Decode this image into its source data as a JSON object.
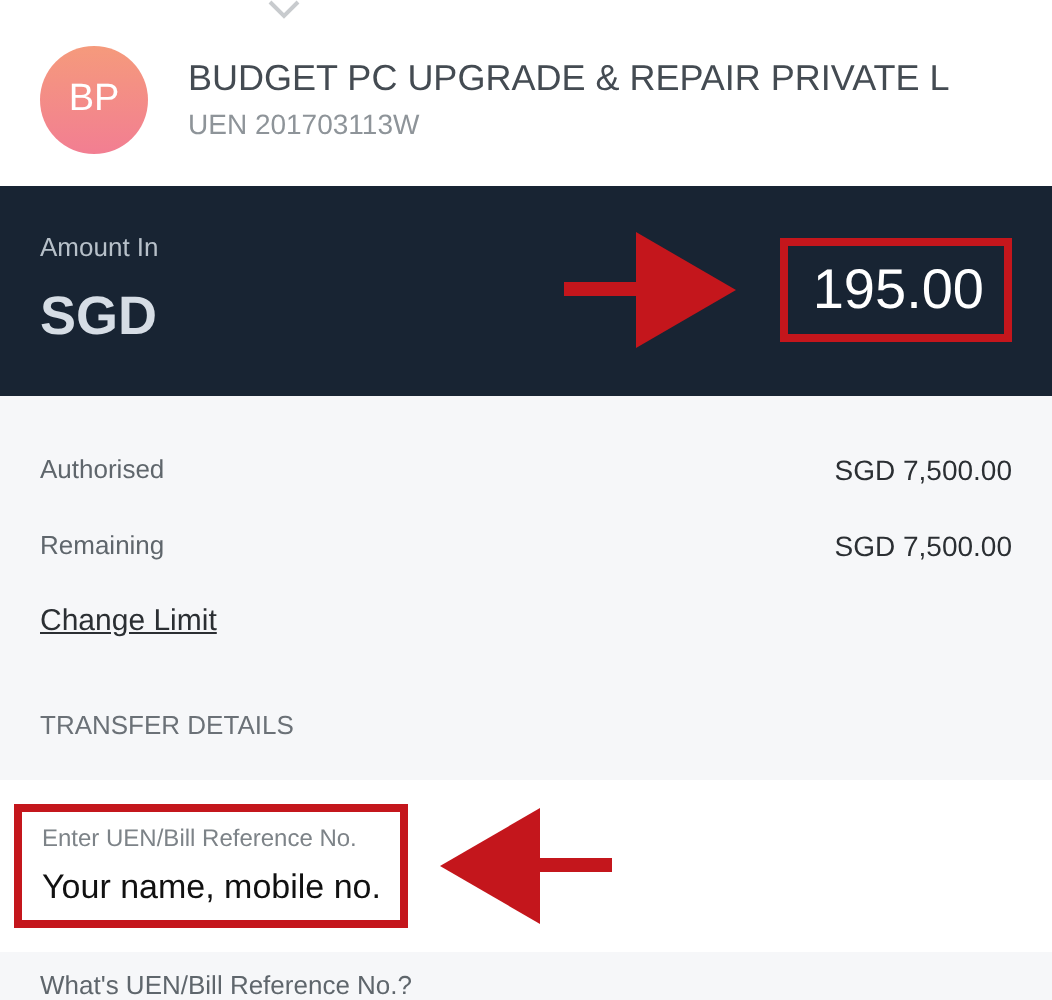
{
  "payee": {
    "initials": "BP",
    "name": "BUDGET PC UPGRADE & REPAIR PRIVATE L",
    "uen": "UEN 201703113W"
  },
  "amount": {
    "label": "Amount In",
    "currency": "SGD",
    "value": "195.00",
    "highlighted": true
  },
  "limits": [
    {
      "label": "Authorised",
      "value": "SGD 7,500.00"
    },
    {
      "label": "Remaining",
      "value": "SGD 7,500.00"
    }
  ],
  "change_limit": "Change Limit",
  "section_title": "TRANSFER DETAILS",
  "reference_field": {
    "label": "Enter UEN/Bill Reference No.",
    "value": "Your name, mobile no.",
    "highlighted": true
  },
  "help_link": "What's UEN/Bill Reference No.?"
}
